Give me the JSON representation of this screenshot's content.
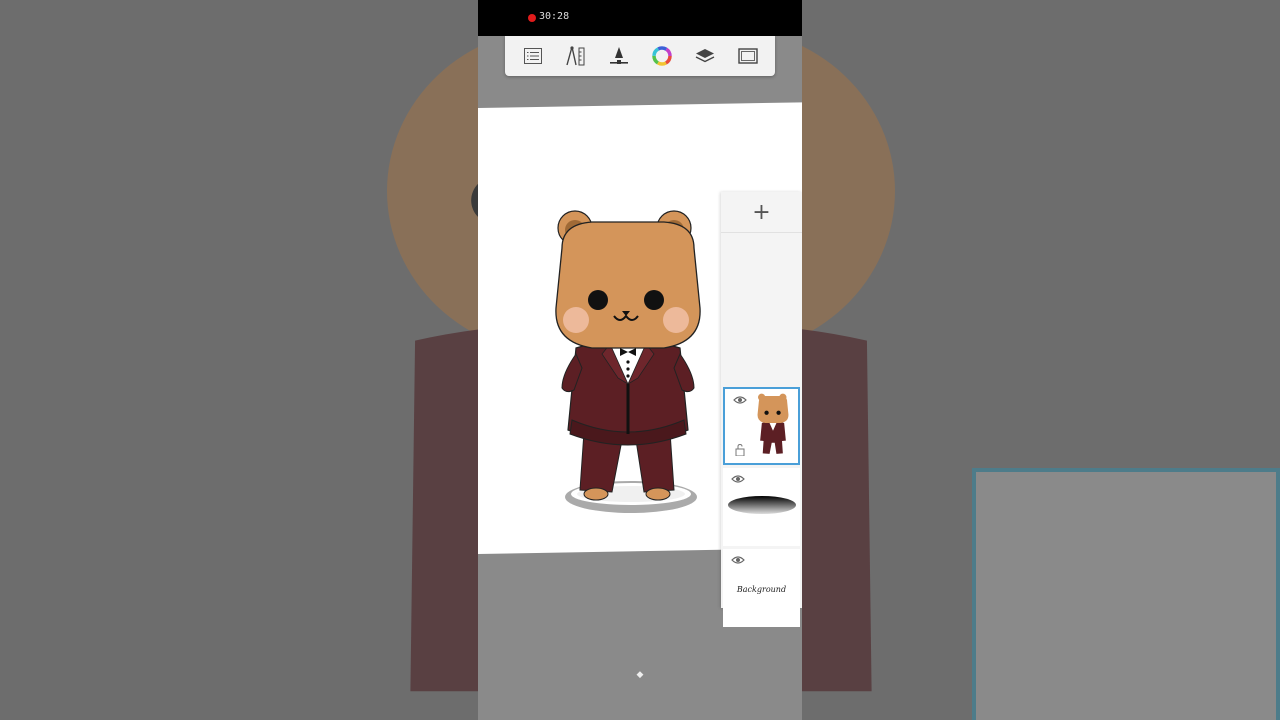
{
  "status_bar": {
    "recording_time": "30:28",
    "recording_color": "#e01b1b"
  },
  "toolbar": {
    "items": [
      {
        "icon": "list-icon",
        "label": "Menu"
      },
      {
        "icon": "ruler-compass-icon",
        "label": "Guides"
      },
      {
        "icon": "brush-icon",
        "label": "Brush"
      },
      {
        "icon": "color-wheel-icon",
        "label": "Color"
      },
      {
        "icon": "layers-icon",
        "label": "Layers"
      },
      {
        "icon": "fullscreen-icon",
        "label": "Canvas"
      }
    ]
  },
  "layers_panel": {
    "add_label": "+",
    "layers": [
      {
        "name": "bear-drawing",
        "visible": true,
        "selected": true,
        "locked": false
      },
      {
        "name": "shadow-ellipse",
        "visible": true,
        "selected": false
      },
      {
        "name": "background",
        "label": "Background",
        "visible": true,
        "selected": false
      }
    ]
  },
  "colors": {
    "fur": "#d4955a",
    "suit": "#5c1f24",
    "selection": "#4a9fd8"
  }
}
